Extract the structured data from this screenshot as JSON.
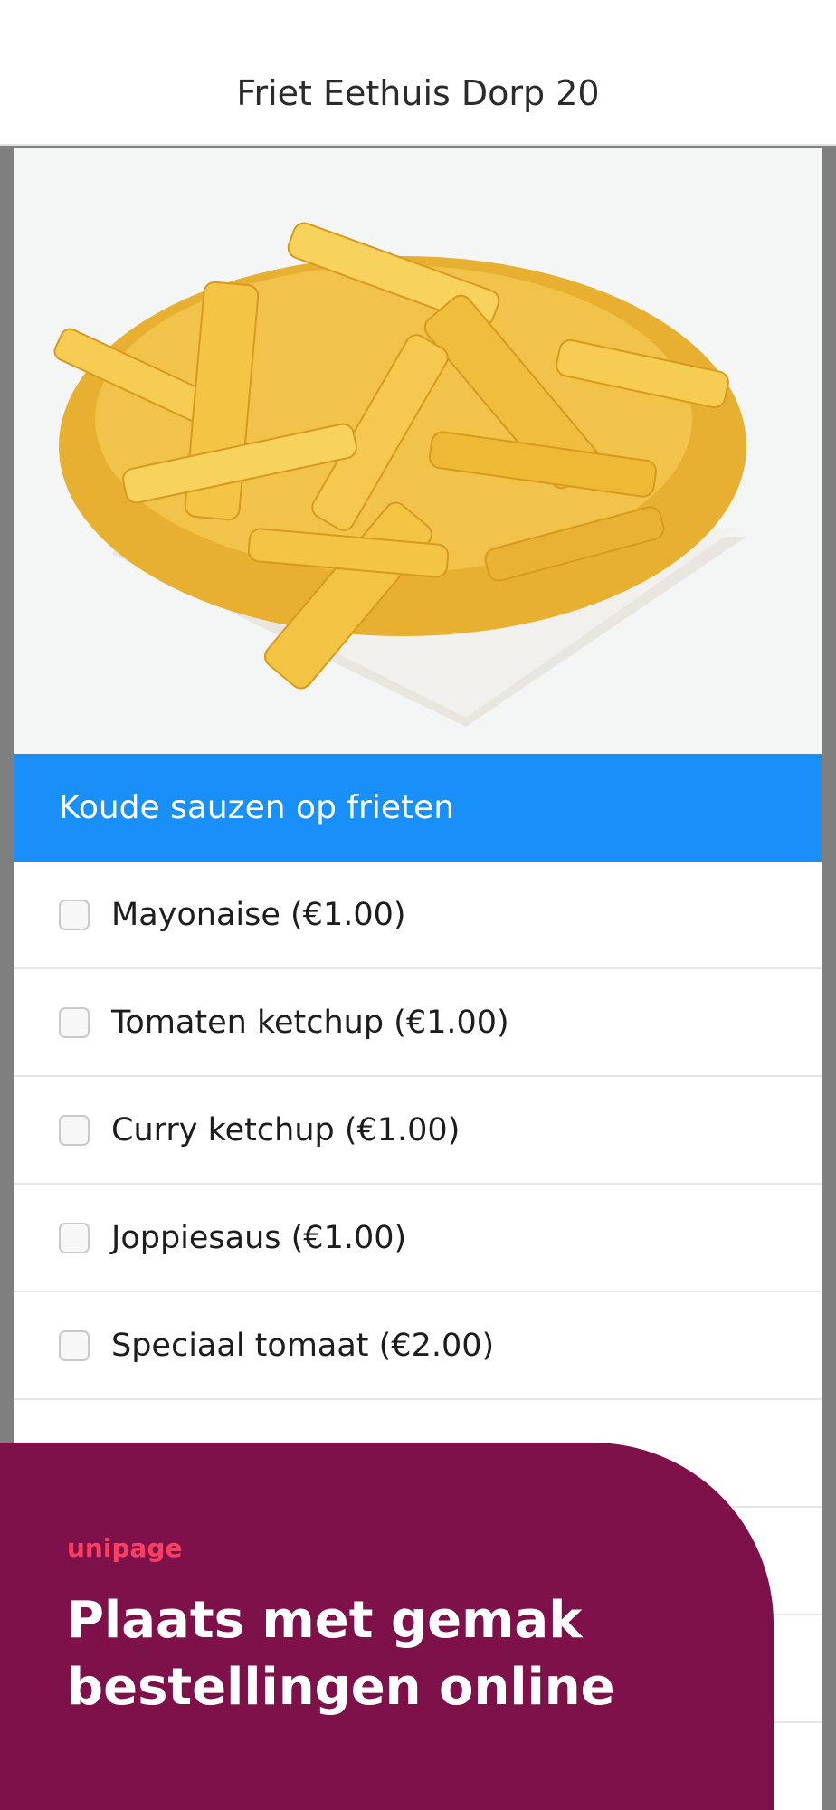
{
  "header": {
    "title": "Friet Eethuis Dorp 20"
  },
  "hero": {
    "image_alt": "Portie friet in een bakje"
  },
  "section": {
    "title": "Koude sauzen op frieten"
  },
  "options": [
    {
      "label": "Mayonaise (€1.00)",
      "checked": false
    },
    {
      "label": "Tomaten ketchup (€1.00)",
      "checked": false
    },
    {
      "label": "Curry ketchup (€1.00)",
      "checked": false
    },
    {
      "label": "Joppiesaus (€1.00)",
      "checked": false
    },
    {
      "label": "Speciaal tomaat (€2.00)",
      "checked": false
    }
  ],
  "promo": {
    "brand": "unipage",
    "headline": "Plaats met gemak bestellingen online"
  },
  "colors": {
    "accent": "#1890f8",
    "promo_bg": "#7e104a",
    "brand": "#ff3d5e"
  }
}
